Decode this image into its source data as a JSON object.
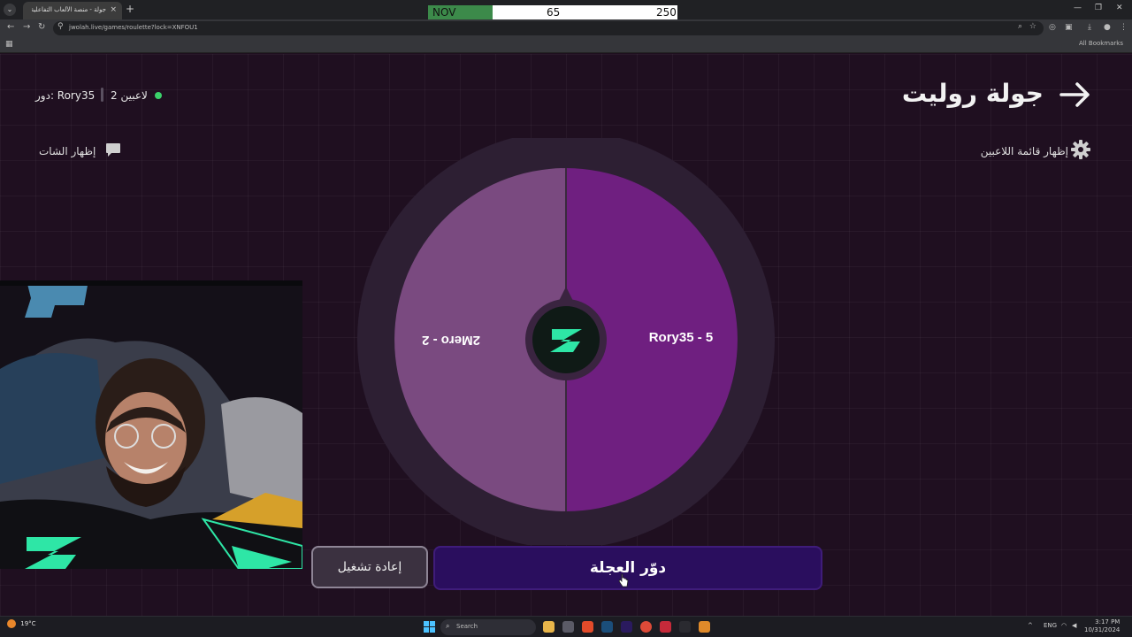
{
  "browser": {
    "tab_title": "جولة - منصة الألعاب التفاعلية - Jooba",
    "tab_close": "×",
    "new_tab": "+",
    "url": "jwolah.live/games/roulette?lock=XNFOU1",
    "all_bookmarks": "All Bookmarks"
  },
  "score_overlay": {
    "team": "NOV",
    "score_a": "65",
    "score_b": "250",
    "team_color": "#3c8a4a"
  },
  "header": {
    "title": "جولة روليت",
    "show_players": "إظهار قائمة اللاعبين",
    "show_chat": "إظهار الشات"
  },
  "status": {
    "turn": "دور: Rory35",
    "players": "2 لاعبين"
  },
  "wheel": {
    "segments": [
      {
        "label": "Rory35 - 5",
        "color": "#6f1f80"
      },
      {
        "label": "2Mero - 2",
        "color": "#7a4a80"
      }
    ],
    "center_logo_color": "#2ee6a6"
  },
  "buttons": {
    "spin": "دوّر العجلة",
    "reset": "إعادة تشغيل"
  },
  "taskbar": {
    "weather": "19°C",
    "search": "Search",
    "lang": "ENG",
    "time": "3:17 PM",
    "date": "10/31/2024"
  },
  "colors": {
    "accent": "#2a0e5e",
    "background": "#1f0f20",
    "online": "#3bd06a"
  }
}
